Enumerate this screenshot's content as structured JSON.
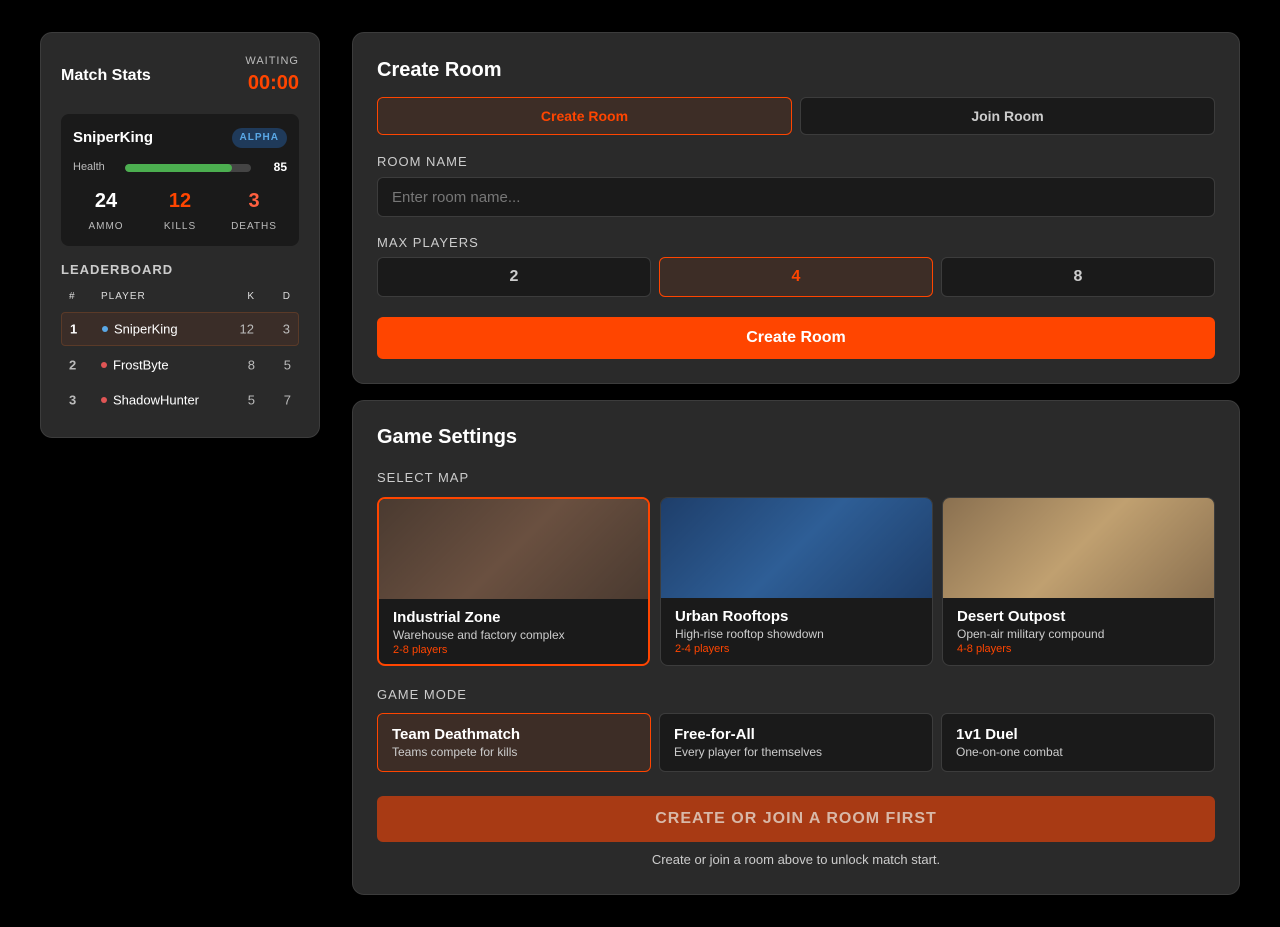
{
  "stats": {
    "title": "Match Stats",
    "status": "WAITING",
    "timer": "00:00",
    "player": {
      "name": "SniperKing",
      "team": "ALPHA",
      "health_label": "Health",
      "health": 85,
      "ammo": "24",
      "ammo_label": "AMMO",
      "kills": "12",
      "kills_label": "KILLS",
      "deaths": "3",
      "deaths_label": "DEATHS"
    },
    "leaderboard": {
      "title": "LEADERBOARD",
      "headers": {
        "rank": "#",
        "player": "PLAYER",
        "k": "K",
        "d": "D"
      },
      "rows": [
        {
          "rank": "1",
          "name": "SniperKing",
          "k": "12",
          "d": "3",
          "dot": "#5aa8e6"
        },
        {
          "rank": "2",
          "name": "FrostByte",
          "k": "8",
          "d": "5",
          "dot": "#e05555"
        },
        {
          "rank": "3",
          "name": "ShadowHunter",
          "k": "5",
          "d": "7",
          "dot": "#e05555"
        }
      ]
    }
  },
  "room": {
    "title": "Create Room",
    "tabs": {
      "create": "Create Room",
      "join": "Join Room"
    },
    "room_name_label": "ROOM NAME",
    "room_name_placeholder": "Enter room name...",
    "room_name_value": "",
    "max_players_label": "MAX PLAYERS",
    "max_players_options": [
      "2",
      "4",
      "8"
    ],
    "max_players_selected": "4",
    "create_button": "Create Room"
  },
  "settings": {
    "title": "Game Settings",
    "map_label": "SELECT MAP",
    "maps": [
      {
        "name": "Industrial Zone",
        "desc": "Warehouse and factory complex",
        "players": "2-8 players",
        "c1": "#4a3a30",
        "c2": "#6a5040"
      },
      {
        "name": "Urban Rooftops",
        "desc": "High-rise rooftop showdown",
        "players": "2-4 players",
        "c1": "#1e3e6a",
        "c2": "#2e5e96"
      },
      {
        "name": "Desert Outpost",
        "desc": "Open-air military compound",
        "players": "4-8 players",
        "c1": "#8a7050",
        "c2": "#c0a070"
      }
    ],
    "map_selected": "Industrial Zone",
    "mode_label": "GAME MODE",
    "modes": [
      {
        "name": "Team Deathmatch",
        "desc": "Teams compete for kills"
      },
      {
        "name": "Free-for-All",
        "desc": "Every player for themselves"
      },
      {
        "name": "1v1 Duel",
        "desc": "One-on-one combat"
      }
    ],
    "mode_selected": "Team Deathmatch",
    "start_button": "CREATE OR JOIN A ROOM FIRST",
    "hint": "Create or join a room above to unlock match start."
  },
  "colors": {
    "accent": "#ff4500",
    "health": "#4caf50",
    "team_alpha": "#5aa8e6"
  }
}
